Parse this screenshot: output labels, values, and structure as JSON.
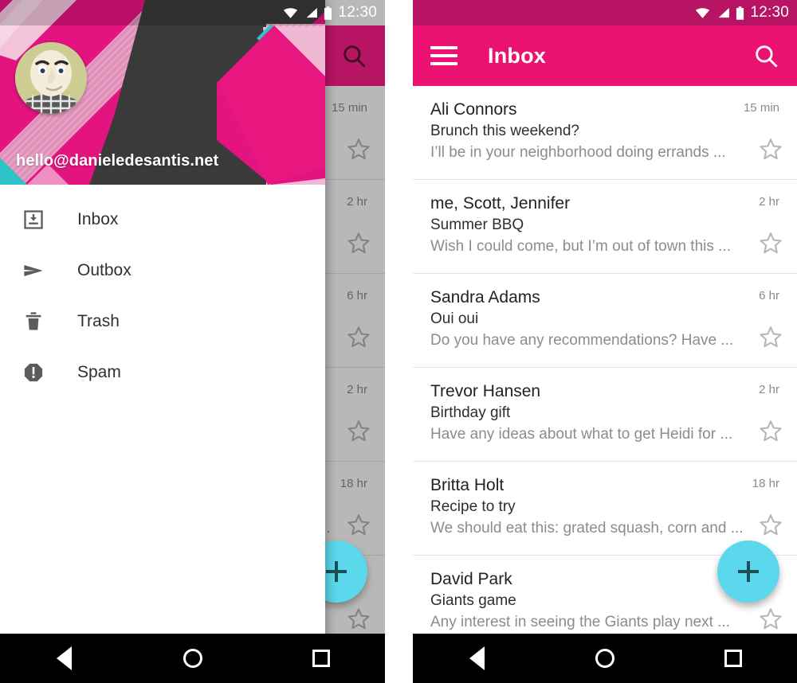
{
  "status_bar": {
    "time": "12:30",
    "icons": [
      "wifi-icon",
      "cellular-signal-icon",
      "battery-icon"
    ]
  },
  "app_bar": {
    "title": "Inbox",
    "menu_icon": "hamburger-menu-icon",
    "search_icon": "search-icon"
  },
  "drawer": {
    "account_email": "hello@danieledesantis.net",
    "avatar_alt": "user-avatar",
    "items": [
      {
        "label": "Inbox",
        "icon": "inbox-icon"
      },
      {
        "label": "Outbox",
        "icon": "send-icon"
      },
      {
        "label": "Trash",
        "icon": "trash-icon"
      },
      {
        "label": "Spam",
        "icon": "report-icon"
      }
    ]
  },
  "fab": {
    "icon": "plus-icon",
    "label": "Compose",
    "color": "#5bd8eb"
  },
  "nav_bar": {
    "back": "back-triangle-icon",
    "home": "home-circle-icon",
    "recents": "recents-square-icon"
  },
  "colors": {
    "primary": "#ec1272",
    "primary_dark": "#b81464",
    "accent": "#5bd8eb",
    "header_magenta": "#e3137f",
    "header_dark": "#3a3a3a",
    "header_pink_light": "#e8a0c4",
    "header_teal": "#2ec3c8"
  },
  "mail_list": {
    "star_icon": "star-outline-icon",
    "messages": [
      {
        "sender": "Ali Connors",
        "subject": "Brunch this weekend?",
        "snippet": "I’ll be in your neighborhood doing errands ...",
        "time": "15 min",
        "starred": false
      },
      {
        "sender": "me, Scott, Jennifer",
        "subject": "Summer BBQ",
        "snippet": "Wish I could come, but I’m out of town this ...",
        "time": "2 hr",
        "starred": false
      },
      {
        "sender": "Sandra Adams",
        "subject": "Oui oui",
        "snippet": "Do you have any recommendations? Have ...",
        "time": "6 hr",
        "starred": false
      },
      {
        "sender": "Trevor Hansen",
        "subject": "Birthday gift",
        "snippet": "Have any ideas about what to get Heidi for ...",
        "time": "2 hr",
        "starred": false
      },
      {
        "sender": "Britta Holt",
        "subject": "Recipe to try",
        "snippet": "We should eat this: grated squash, corn and ...",
        "time": "18 hr",
        "starred": false
      },
      {
        "sender": "David Park",
        "subject": "Giants game",
        "snippet": "Any interest in seeing the Giants play next ...",
        "time": "",
        "starred": false
      }
    ]
  }
}
